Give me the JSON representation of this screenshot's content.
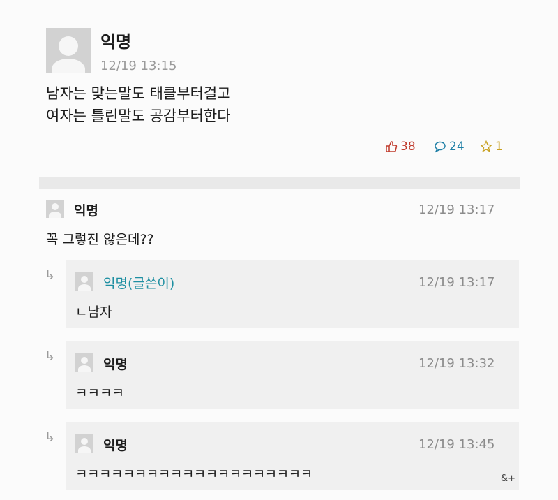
{
  "post": {
    "author": "익명",
    "time": "12/19 13:15",
    "lines": [
      "남자는 맞는말도 태클부터걸고",
      "여자는 틀린말도 공감부터한다"
    ],
    "likes": "38",
    "comments": "24",
    "scraps": "1",
    "colors": {
      "likes": "#c0392b",
      "comments": "#1e7fa6",
      "scraps": "#c8a020"
    }
  },
  "comments": [
    {
      "author": "익명",
      "time": "12/19 13:17",
      "text": "꼭 그렇진 않은데??"
    }
  ],
  "replies": [
    {
      "author": "익명(글쓴이)",
      "time": "12/19 13:17",
      "text": "ㄴ남자"
    },
    {
      "author": "익명",
      "time": "12/19 13:32",
      "text": "ㅋㅋㅋㅋ"
    },
    {
      "author": "익명",
      "time": "12/19 13:45",
      "text": "ㅋㅋㅋㅋㅋㅋㅋㅋㅋㅋㅋㅋㅋㅋㅋㅋㅋㅋㅋㅋ"
    }
  ],
  "reply_arrow": "↳",
  "watermark": "&+"
}
